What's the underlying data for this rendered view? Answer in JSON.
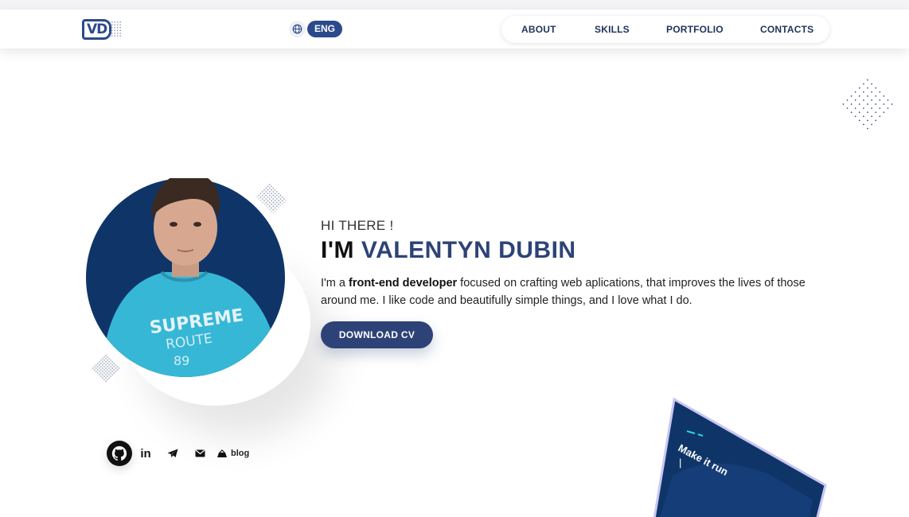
{
  "header": {
    "logo_text": "VD",
    "language": "ENG",
    "nav": [
      "ABOUT",
      "SKILLS",
      "PORTFOLIO",
      "CONTACTS"
    ]
  },
  "hero": {
    "greeting": "HI THERE !",
    "name_prefix": "I'M",
    "name": "VALENTYN DUBIN",
    "bio_1": "I'm a ",
    "bio_strong": "front-end developer",
    "bio_2": " focused on crafting web aplications, that improves the lives of those around me. I like code and beautifully simple things, and I love what I do.",
    "cv_button": "DOWNLOAD CV"
  },
  "socials": {
    "items": [
      "github-icon",
      "linkedin-icon",
      "telegram-icon",
      "mail-icon",
      "blog-icon"
    ],
    "linkedin_label": "in",
    "blog_label": "blog"
  },
  "laptop": {
    "screen_text": "Make it run",
    "cursor": "|"
  },
  "colors": {
    "brand": "#2d4378",
    "accent_cyan": "#2ad4e0",
    "text": "#1a1a1a",
    "shirt": "#36b7d6"
  }
}
